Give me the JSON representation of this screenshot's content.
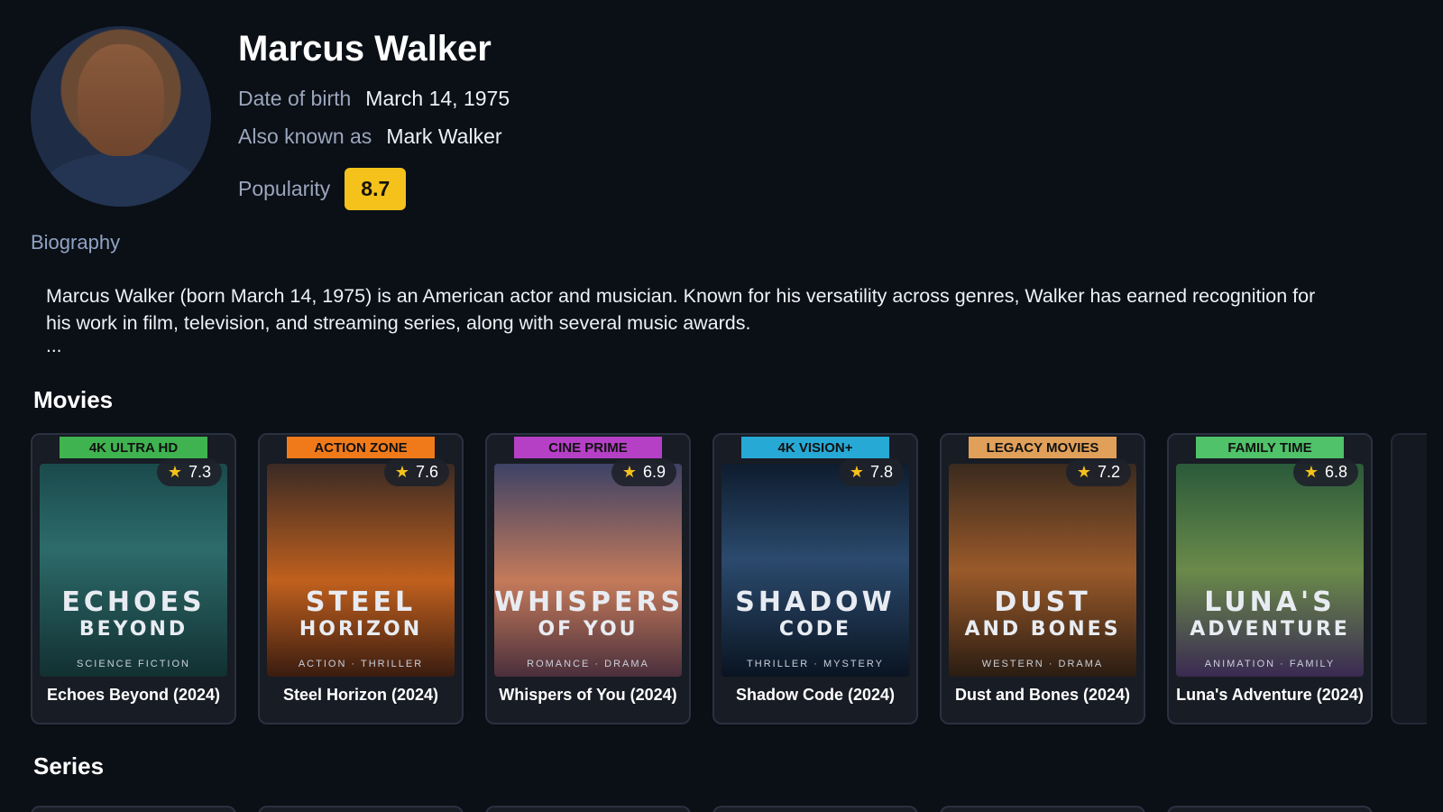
{
  "person": {
    "name": "Marcus Walker",
    "dob_label": "Date of birth",
    "dob_value": "March 14, 1975",
    "aka_label": "Also known as",
    "aka_value": "Mark Walker",
    "popularity_label": "Popularity",
    "popularity_value": "8.7"
  },
  "biography": {
    "heading": "Biography",
    "text": "Marcus Walker (born March 14, 1975) is an American actor and musician. Known for his versatility across genres, Walker has earned recognition for his work in film, television, and streaming series, along with several music awards.",
    "ellipsis": "..."
  },
  "sections": {
    "movies_title": "Movies",
    "series_title": "Series"
  },
  "movies": [
    {
      "tag": "4K ULTRA HD",
      "tag_color": "#3fb34f",
      "rating": "7.3",
      "poster_title": "ECHOES",
      "poster_sub": "BEYOND",
      "poster_genre": "SCIENCE FICTION",
      "caption": "Echoes Beyond (2024)",
      "grad": "linear-gradient(#1a4a4c, #2d6b6a 40%, #123032)"
    },
    {
      "tag": "ACTION ZONE",
      "tag_color": "#f07a1a",
      "rating": "7.6",
      "poster_title": "STEEL",
      "poster_sub": "HORIZON",
      "poster_genre": "ACTION · THRILLER",
      "caption": "Steel Horizon (2024)",
      "grad": "linear-gradient(#3a2a24, #c0601e 55%, #3a1c10)"
    },
    {
      "tag": "CINE PRIME",
      "tag_color": "#b540c6",
      "rating": "6.9",
      "poster_title": "WHISPERS",
      "poster_sub": "OF YOU",
      "poster_genre": "ROMANCE · DRAMA",
      "caption": "Whispers of You (2024)",
      "grad": "linear-gradient(#3d4266, #c47a5a 55%, #4a2f3c)"
    },
    {
      "tag": "4K VISION+",
      "tag_color": "#27a9d6",
      "rating": "7.8",
      "poster_title": "SHADOW",
      "poster_sub": "CODE",
      "poster_genre": "THRILLER · MYSTERY",
      "caption": "Shadow Code (2024)",
      "grad": "linear-gradient(#0e1c2e, #2b4a6d 45%, #0a1422)"
    },
    {
      "tag": "LEGACY MOVIES",
      "tag_color": "#e0a05a",
      "rating": "7.2",
      "poster_title": "DUST",
      "poster_sub": "AND BONES",
      "poster_genre": "WESTERN · DRAMA",
      "caption": "Dust and Bones (2024)",
      "grad": "linear-gradient(#3a2a1e, #9a5a2a 50%, #2a1c12)"
    },
    {
      "tag": "FAMILY TIME",
      "tag_color": "#4fc26a",
      "rating": "6.8",
      "poster_title": "LUNA'S",
      "poster_sub": "ADVENTURE",
      "poster_genre": "ANIMATION · FAMILY",
      "caption": "Luna's Adventure (2024)",
      "grad": "linear-gradient(#2a5a3a, #6a8a4a 50%, #3a2a52)"
    }
  ],
  "colors": {
    "accent": "#f5c21b",
    "background": "#0b0f16"
  }
}
